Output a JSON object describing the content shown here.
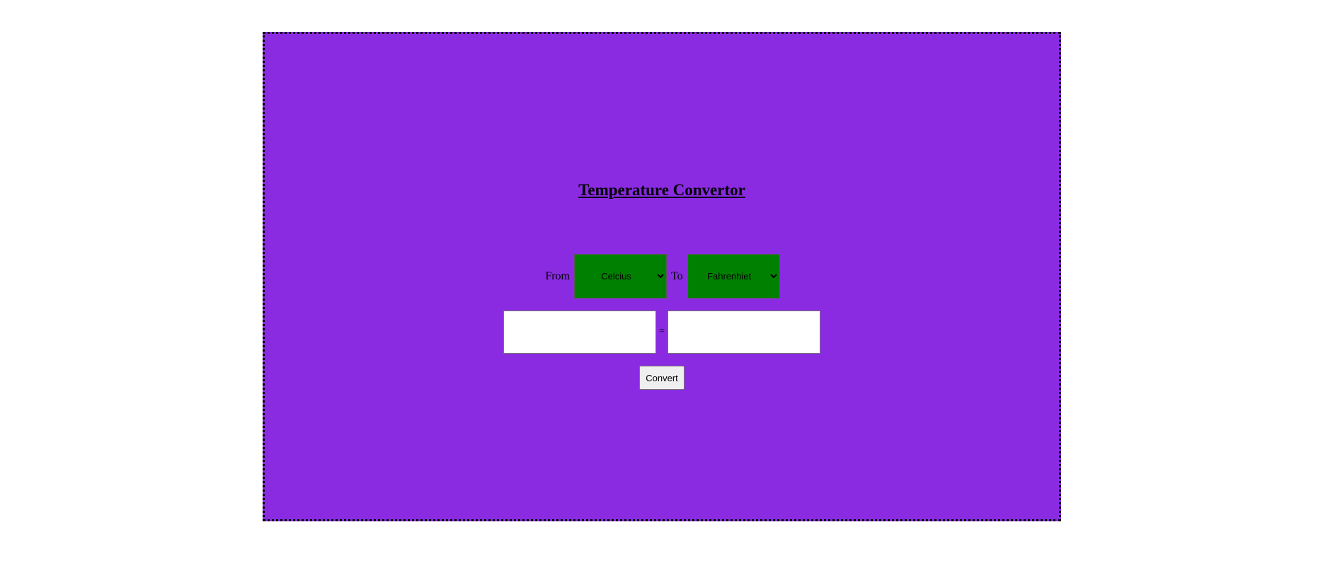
{
  "header": {
    "title": "Temperature Convertor"
  },
  "converter": {
    "from_label": "From",
    "to_label": "To",
    "from_unit": "Celcius",
    "to_unit": "Fahrenhiet",
    "equals_label": "=",
    "input_value": "",
    "output_value": "",
    "convert_label": "Convert"
  },
  "colors": {
    "panel_background": "#8a2be2",
    "select_background": "#008000",
    "page_background": "#ffffff"
  }
}
